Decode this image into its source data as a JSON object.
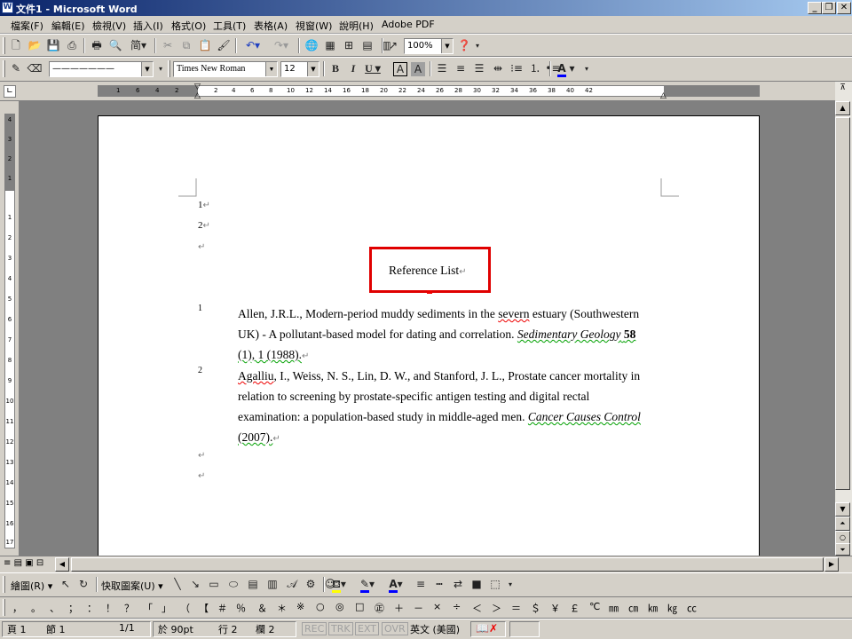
{
  "window": {
    "title": "文件1 - Microsoft Word",
    "app_icon": "W"
  },
  "menu": [
    "檔案(F)",
    "編輯(E)",
    "檢視(V)",
    "插入(I)",
    "格式(O)",
    "工具(T)",
    "表格(A)",
    "視窗(W)",
    "說明(H)",
    "Adobe PDF"
  ],
  "standard_toolbar": {
    "zoom": "100%"
  },
  "format_toolbar": {
    "style": "———————",
    "font": "Times New Roman",
    "size": "12",
    "font_color": "#0000ff",
    "highlight_color": "#ffff00"
  },
  "ruler_numbers": [
    "1",
    "6",
    "4",
    "2",
    "2",
    "4",
    "6",
    "8",
    "10",
    "12",
    "14",
    "16",
    "18",
    "20",
    "22",
    "24",
    "26",
    "28",
    "30",
    "32",
    "34",
    "36",
    "38",
    "40",
    "42"
  ],
  "vruler_numbers": [
    "4",
    "3",
    "2",
    "1",
    "1",
    "2",
    "3",
    "4",
    "5",
    "6",
    "7",
    "8",
    "9",
    "10",
    "11",
    "12",
    "13",
    "14",
    "15",
    "16",
    "17"
  ],
  "document": {
    "line_numbers": [
      "1",
      "2"
    ],
    "heading": "Reference List",
    "refs": [
      {
        "num": "1",
        "parts": [
          "Allen, J.R.L., Modern-period muddy sediments in the ",
          "severn",
          " estuary (Southwestern UK) - A pollutant-based model for dating and correlation. ",
          "Sedimentary Geology",
          " ",
          "58",
          " (1), 1 (1988)."
        ]
      },
      {
        "num": "2",
        "parts": [
          "Agalliu",
          ", I., Weiss, N. S., Lin, D. W., and Stanford, J. L., Prostate cancer mortality in relation to screening by prostate-specific antigen testing and digital rectal examination: a population-based study in middle-aged men. ",
          "Cancer Causes Control",
          " (2007)."
        ]
      }
    ],
    "highlight_color": "#e00000"
  },
  "drawing_toolbar": {
    "draw_label": "繪圖(R)",
    "autoshape_label": "快取圖案(U)"
  },
  "symbols": [
    "，",
    "。",
    "、",
    "；",
    "：",
    "！",
    "？",
    "「",
    "」",
    "（",
    "【",
    "＃",
    "％",
    "＆",
    "＊",
    "※",
    "○",
    "◎",
    "□",
    "㊣",
    "＋",
    "－",
    "×",
    "÷",
    "＜",
    "＞",
    "＝",
    "＄",
    "￥",
    "￡",
    "℃",
    "㎜",
    "㎝",
    "㎞",
    "㎏",
    "㏄"
  ],
  "status": {
    "page": "頁 1",
    "section": "節 1",
    "pages": "1/1",
    "at": "於 90pt",
    "line": "行 2",
    "col": "欄 2",
    "rec": "REC",
    "trk": "TRK",
    "ext": "EXT",
    "ovr": "OVR",
    "lang": "英文 (美國)"
  }
}
